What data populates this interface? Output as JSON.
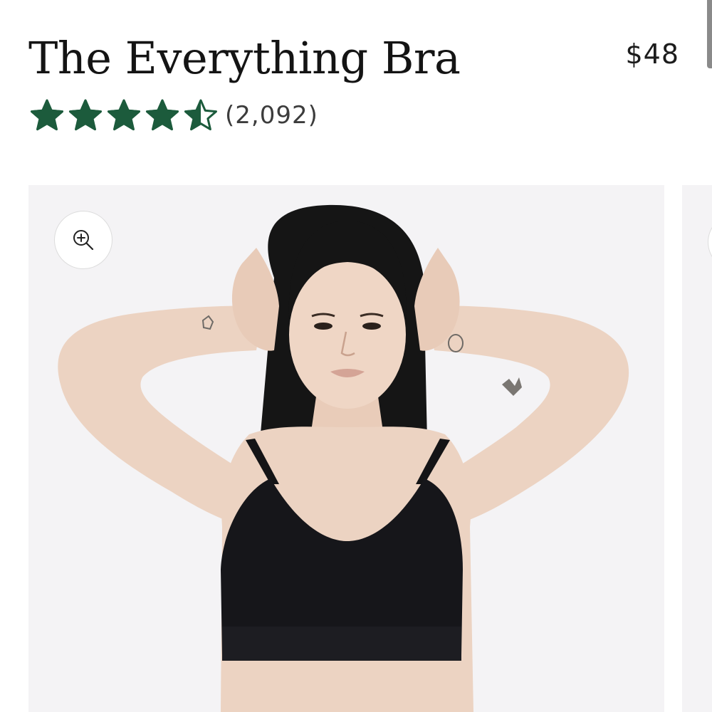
{
  "product": {
    "title": "The Everything Bra",
    "price": "$48"
  },
  "rating": {
    "value": 4.5,
    "max": 5,
    "review_count_text": "(2,092)",
    "star_color": "#1c5b3c"
  },
  "gallery": {
    "zoom_icon": "zoom-in-icon",
    "background_color": "#f4f3f5"
  }
}
